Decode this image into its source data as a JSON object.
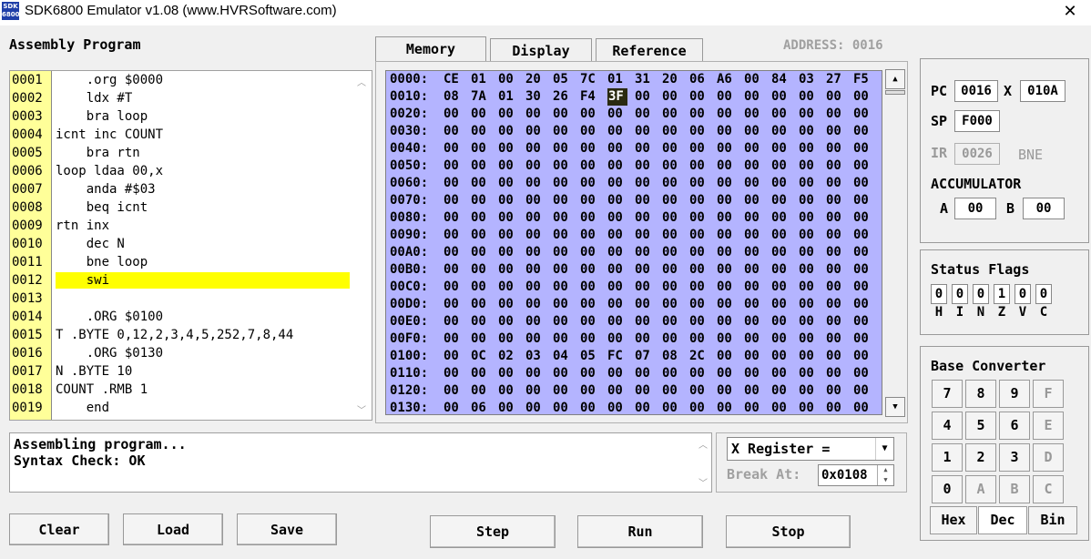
{
  "window": {
    "icon_text": "SDK 6800",
    "title": "SDK6800 Emulator v1.08 (www.HVRSoftware.com)",
    "close_glyph": "✕"
  },
  "editor": {
    "label": "Assembly Program",
    "highlight_line": 12,
    "lines": [
      {
        "num": "0001",
        "text": "    .org $0000"
      },
      {
        "num": "0002",
        "text": "    ldx #T"
      },
      {
        "num": "0003",
        "text": "    bra loop"
      },
      {
        "num": "0004",
        "text": "icnt inc COUNT"
      },
      {
        "num": "0005",
        "text": "    bra rtn"
      },
      {
        "num": "0006",
        "text": "loop ldaa 00,x"
      },
      {
        "num": "0007",
        "text": "    anda #$03"
      },
      {
        "num": "0008",
        "text": "    beq icnt"
      },
      {
        "num": "0009",
        "text": "rtn inx"
      },
      {
        "num": "0010",
        "text": "    dec N"
      },
      {
        "num": "0011",
        "text": "    bne loop"
      },
      {
        "num": "0012",
        "text": "    swi"
      },
      {
        "num": "0013",
        "text": ""
      },
      {
        "num": "0014",
        "text": "    .ORG $0100"
      },
      {
        "num": "0015",
        "text": "T .BYTE 0,12,2,3,4,5,252,7,8,44"
      },
      {
        "num": "0016",
        "text": "    .ORG $0130"
      },
      {
        "num": "0017",
        "text": "N .BYTE 10"
      },
      {
        "num": "0018",
        "text": "COUNT .RMB 1"
      },
      {
        "num": "0019",
        "text": "    end"
      }
    ]
  },
  "tabs": [
    {
      "label": "Memory",
      "active": true
    },
    {
      "label": "Display",
      "active": false
    },
    {
      "label": "Reference",
      "active": false
    }
  ],
  "address_label": "ADDRESS: 0016",
  "memory": {
    "selected": {
      "row": 1,
      "col": 6
    },
    "rows": [
      {
        "addr": "0000:",
        "bytes": [
          "CE",
          "01",
          "00",
          "20",
          "05",
          "7C",
          "01",
          "31",
          "20",
          "06",
          "A6",
          "00",
          "84",
          "03",
          "27",
          "F5"
        ]
      },
      {
        "addr": "0010:",
        "bytes": [
          "08",
          "7A",
          "01",
          "30",
          "26",
          "F4",
          "3F",
          "00",
          "00",
          "00",
          "00",
          "00",
          "00",
          "00",
          "00",
          "00"
        ]
      },
      {
        "addr": "0020:",
        "bytes": [
          "00",
          "00",
          "00",
          "00",
          "00",
          "00",
          "00",
          "00",
          "00",
          "00",
          "00",
          "00",
          "00",
          "00",
          "00",
          "00"
        ]
      },
      {
        "addr": "0030:",
        "bytes": [
          "00",
          "00",
          "00",
          "00",
          "00",
          "00",
          "00",
          "00",
          "00",
          "00",
          "00",
          "00",
          "00",
          "00",
          "00",
          "00"
        ]
      },
      {
        "addr": "0040:",
        "bytes": [
          "00",
          "00",
          "00",
          "00",
          "00",
          "00",
          "00",
          "00",
          "00",
          "00",
          "00",
          "00",
          "00",
          "00",
          "00",
          "00"
        ]
      },
      {
        "addr": "0050:",
        "bytes": [
          "00",
          "00",
          "00",
          "00",
          "00",
          "00",
          "00",
          "00",
          "00",
          "00",
          "00",
          "00",
          "00",
          "00",
          "00",
          "00"
        ]
      },
      {
        "addr": "0060:",
        "bytes": [
          "00",
          "00",
          "00",
          "00",
          "00",
          "00",
          "00",
          "00",
          "00",
          "00",
          "00",
          "00",
          "00",
          "00",
          "00",
          "00"
        ]
      },
      {
        "addr": "0070:",
        "bytes": [
          "00",
          "00",
          "00",
          "00",
          "00",
          "00",
          "00",
          "00",
          "00",
          "00",
          "00",
          "00",
          "00",
          "00",
          "00",
          "00"
        ]
      },
      {
        "addr": "0080:",
        "bytes": [
          "00",
          "00",
          "00",
          "00",
          "00",
          "00",
          "00",
          "00",
          "00",
          "00",
          "00",
          "00",
          "00",
          "00",
          "00",
          "00"
        ]
      },
      {
        "addr": "0090:",
        "bytes": [
          "00",
          "00",
          "00",
          "00",
          "00",
          "00",
          "00",
          "00",
          "00",
          "00",
          "00",
          "00",
          "00",
          "00",
          "00",
          "00"
        ]
      },
      {
        "addr": "00A0:",
        "bytes": [
          "00",
          "00",
          "00",
          "00",
          "00",
          "00",
          "00",
          "00",
          "00",
          "00",
          "00",
          "00",
          "00",
          "00",
          "00",
          "00"
        ]
      },
      {
        "addr": "00B0:",
        "bytes": [
          "00",
          "00",
          "00",
          "00",
          "00",
          "00",
          "00",
          "00",
          "00",
          "00",
          "00",
          "00",
          "00",
          "00",
          "00",
          "00"
        ]
      },
      {
        "addr": "00C0:",
        "bytes": [
          "00",
          "00",
          "00",
          "00",
          "00",
          "00",
          "00",
          "00",
          "00",
          "00",
          "00",
          "00",
          "00",
          "00",
          "00",
          "00"
        ]
      },
      {
        "addr": "00D0:",
        "bytes": [
          "00",
          "00",
          "00",
          "00",
          "00",
          "00",
          "00",
          "00",
          "00",
          "00",
          "00",
          "00",
          "00",
          "00",
          "00",
          "00"
        ]
      },
      {
        "addr": "00E0:",
        "bytes": [
          "00",
          "00",
          "00",
          "00",
          "00",
          "00",
          "00",
          "00",
          "00",
          "00",
          "00",
          "00",
          "00",
          "00",
          "00",
          "00"
        ]
      },
      {
        "addr": "00F0:",
        "bytes": [
          "00",
          "00",
          "00",
          "00",
          "00",
          "00",
          "00",
          "00",
          "00",
          "00",
          "00",
          "00",
          "00",
          "00",
          "00",
          "00"
        ]
      },
      {
        "addr": "0100:",
        "bytes": [
          "00",
          "0C",
          "02",
          "03",
          "04",
          "05",
          "FC",
          "07",
          "08",
          "2C",
          "00",
          "00",
          "00",
          "00",
          "00",
          "00"
        ]
      },
      {
        "addr": "0110:",
        "bytes": [
          "00",
          "00",
          "00",
          "00",
          "00",
          "00",
          "00",
          "00",
          "00",
          "00",
          "00",
          "00",
          "00",
          "00",
          "00",
          "00"
        ]
      },
      {
        "addr": "0120:",
        "bytes": [
          "00",
          "00",
          "00",
          "00",
          "00",
          "00",
          "00",
          "00",
          "00",
          "00",
          "00",
          "00",
          "00",
          "00",
          "00",
          "00"
        ]
      },
      {
        "addr": "0130:",
        "bytes": [
          "00",
          "06",
          "00",
          "00",
          "00",
          "00",
          "00",
          "00",
          "00",
          "00",
          "00",
          "00",
          "00",
          "00",
          "00",
          "00"
        ]
      }
    ]
  },
  "registers": {
    "pc_label": "PC",
    "pc": "0016",
    "x_label": "X",
    "x": "010A",
    "sp_label": "SP",
    "sp": "F000",
    "ir_label": "IR",
    "ir": "0026",
    "ir_mnemonic": "BNE",
    "accumulator_label": "ACCUMULATOR",
    "a_label": "A",
    "a": "00",
    "b_label": "B",
    "b": "00"
  },
  "status_flags": {
    "label": "Status Flags",
    "values": [
      "0",
      "0",
      "0",
      "1",
      "0",
      "0"
    ],
    "names": [
      "H",
      "I",
      "N",
      "Z",
      "V",
      "C"
    ]
  },
  "base_converter": {
    "label": "Base Converter",
    "keys": [
      {
        "k": "7",
        "enabled": true
      },
      {
        "k": "8",
        "enabled": true
      },
      {
        "k": "9",
        "enabled": true
      },
      {
        "k": "F",
        "enabled": false
      },
      {
        "k": "4",
        "enabled": true
      },
      {
        "k": "5",
        "enabled": true
      },
      {
        "k": "6",
        "enabled": true
      },
      {
        "k": "E",
        "enabled": false
      },
      {
        "k": "1",
        "enabled": true
      },
      {
        "k": "2",
        "enabled": true
      },
      {
        "k": "3",
        "enabled": true
      },
      {
        "k": "D",
        "enabled": false
      },
      {
        "k": "0",
        "enabled": true
      },
      {
        "k": "A",
        "enabled": false
      },
      {
        "k": "B",
        "enabled": false
      },
      {
        "k": "C",
        "enabled": false
      }
    ],
    "modes": [
      {
        "label": "Hex",
        "active": false
      },
      {
        "label": "Dec",
        "active": true
      },
      {
        "label": "Bin",
        "active": false
      }
    ]
  },
  "output": {
    "lines": [
      "Assembling program...",
      "Syntax Check: OK"
    ]
  },
  "watch": {
    "select_value": "X Register =",
    "break_label": "Break At:",
    "break_value": "0x0108"
  },
  "buttons": {
    "clear": "Clear",
    "load": "Load",
    "save": "Save",
    "step": "Step",
    "run": "Run",
    "stop": "Stop"
  }
}
